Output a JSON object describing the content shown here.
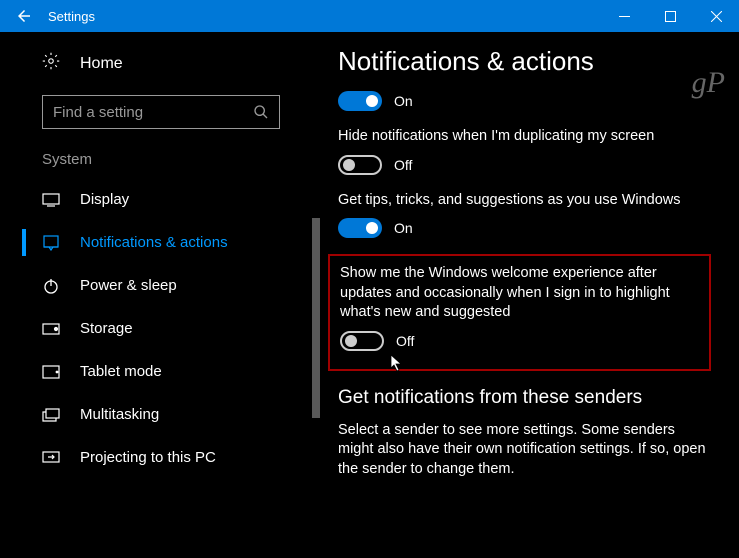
{
  "titlebar": {
    "title": "Settings"
  },
  "sidebar": {
    "home": "Home",
    "search_placeholder": "Find a setting",
    "category": "System",
    "items": [
      {
        "label": "Display",
        "icon": "display"
      },
      {
        "label": "Notifications & actions",
        "icon": "notifications",
        "active": true
      },
      {
        "label": "Power & sleep",
        "icon": "power"
      },
      {
        "label": "Storage",
        "icon": "storage"
      },
      {
        "label": "Tablet mode",
        "icon": "tablet"
      },
      {
        "label": "Multitasking",
        "icon": "multitasking"
      },
      {
        "label": "Projecting to this PC",
        "icon": "projecting"
      }
    ]
  },
  "main": {
    "heading": "Notifications & actions",
    "settings": [
      {
        "state": "On",
        "on": true
      },
      {
        "desc": "Hide notifications when I'm duplicating my screen",
        "state": "Off",
        "on": false
      },
      {
        "desc": "Get tips, tricks, and suggestions as you use Windows",
        "state": "On",
        "on": true
      },
      {
        "desc": "Show me the Windows welcome experience after updates and occasionally when I sign in to highlight what's new and suggested",
        "state": "Off",
        "on": false,
        "highlighted": true
      }
    ],
    "subheading": "Get notifications from these senders",
    "subdesc": "Select a sender to see more settings. Some senders might also have their own notification settings. If so, open the sender to change them."
  },
  "watermark": "gP"
}
